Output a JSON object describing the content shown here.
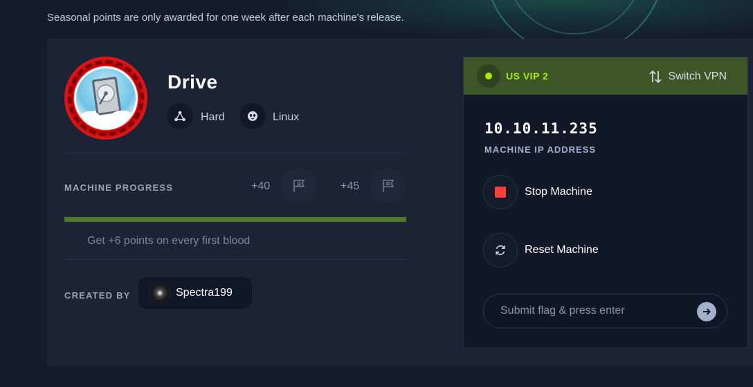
{
  "header": {
    "season_note": "Seasonal points are only awarded for one week after each machine's release."
  },
  "machine": {
    "name": "Drive",
    "difficulty": "Hard",
    "os": "Linux",
    "progress_label": "MACHINE PROGRESS",
    "user_points": "+40",
    "root_points": "+45",
    "progress_percent": 100,
    "bonus_text": "Get +6 points on every first blood",
    "created_by_label": "CREATED BY",
    "creator": "Spectra199"
  },
  "vpn": {
    "server": "US VIP 2",
    "switch_label": "Switch VPN",
    "status_color": "#9fef00",
    "header_color": "#3e5527"
  },
  "instance": {
    "ip": "10.10.11.235",
    "ip_label": "MACHINE IP ADDRESS",
    "stop_label": "Stop Machine",
    "reset_label": "Reset Machine"
  },
  "flag": {
    "placeholder": "Submit flag & press enter",
    "value": ""
  },
  "colors": {
    "accent": "#9fef00",
    "stop": "#ff3e3e",
    "background": "#151c29",
    "card": "#1b2334"
  },
  "icons": {
    "difficulty": "difficulty-icon",
    "os": "linux-icon",
    "user_flag": "user-flag-icon",
    "root_flag": "root-flag-icon",
    "switch": "switch-arrows-icon",
    "stop": "stop-icon",
    "reset": "refresh-icon",
    "submit": "arrow-right-icon"
  }
}
